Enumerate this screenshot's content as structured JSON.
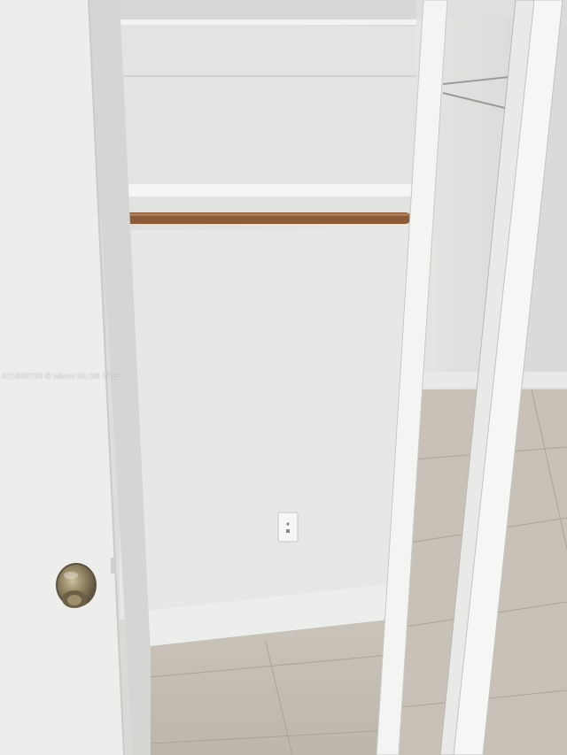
{
  "photo": {
    "watermark": "A11809793 © Miami MLS® 2025"
  },
  "palette": {
    "wall": "#e6e7e4",
    "shelf": "#ececea",
    "rod": "#8b5a36",
    "floor_tile": "#c8c2b8",
    "door": "#eeeeec",
    "mirror_frame": "#f4f4f2",
    "knob": "#8a7a5a"
  }
}
